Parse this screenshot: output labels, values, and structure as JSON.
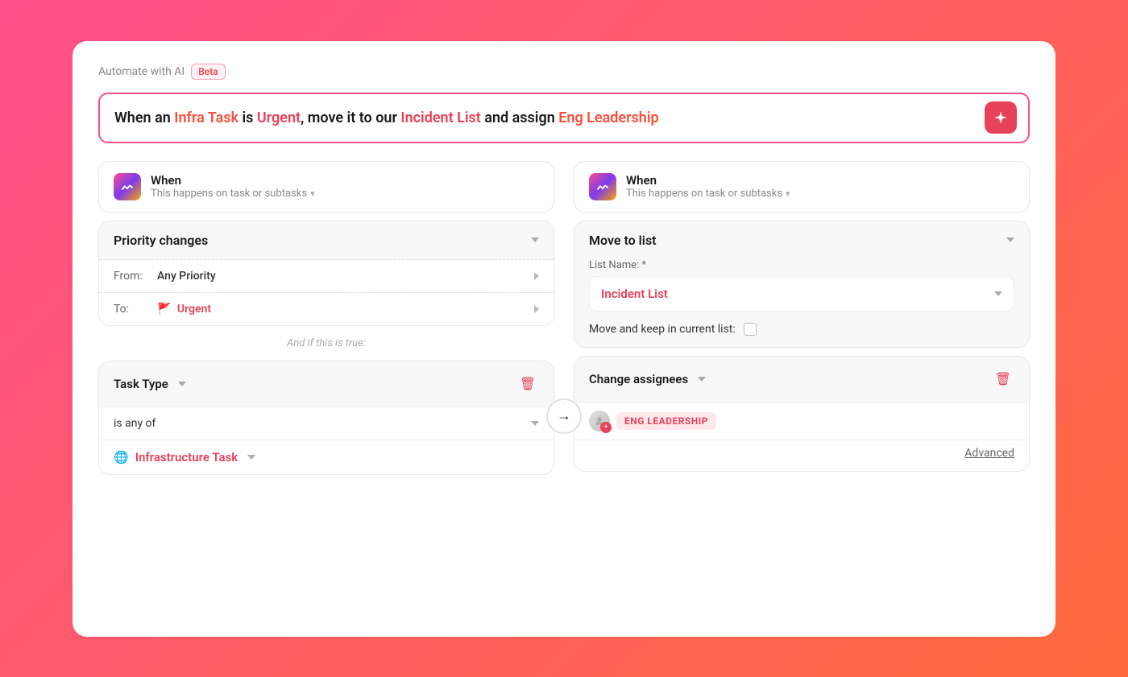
{
  "header": {
    "automate_label": "Automate with AI",
    "beta_label": "Beta"
  },
  "prompt": {
    "part1": "When an ",
    "infra_task": "Infra Task",
    "part2": " is ",
    "urgent": "Urgent",
    "part3": ", move it to our ",
    "incident_list": "Incident List",
    "part4": " and assign ",
    "eng_leadership": "Eng Leadership",
    "ai_button_label": "✦"
  },
  "left_col": {
    "when_card": {
      "title": "When",
      "subtitle": "This happens on task or subtasks"
    },
    "trigger_card": {
      "label": "Priority changes",
      "from_label": "From:",
      "from_value": "Any Priority",
      "to_label": "To:",
      "to_value": "Urgent"
    },
    "and_if_label": "And if this is true:",
    "condition_card": {
      "type_label": "Task Type",
      "operator_label": "is any of",
      "value_label": "Infrastructure Task"
    }
  },
  "right_col": {
    "when_card": {
      "title": "When",
      "subtitle": "This happens on task or subtasks"
    },
    "move_card": {
      "label": "Move to list",
      "list_name_label": "List Name: *",
      "list_value": "Incident List",
      "keep_label": "Move and keep in current list:"
    },
    "assignees_card": {
      "label": "Change assignees",
      "eng_badge": "ENG LEADERSHIP",
      "advanced_link": "Advanced"
    }
  },
  "arrow": "→"
}
